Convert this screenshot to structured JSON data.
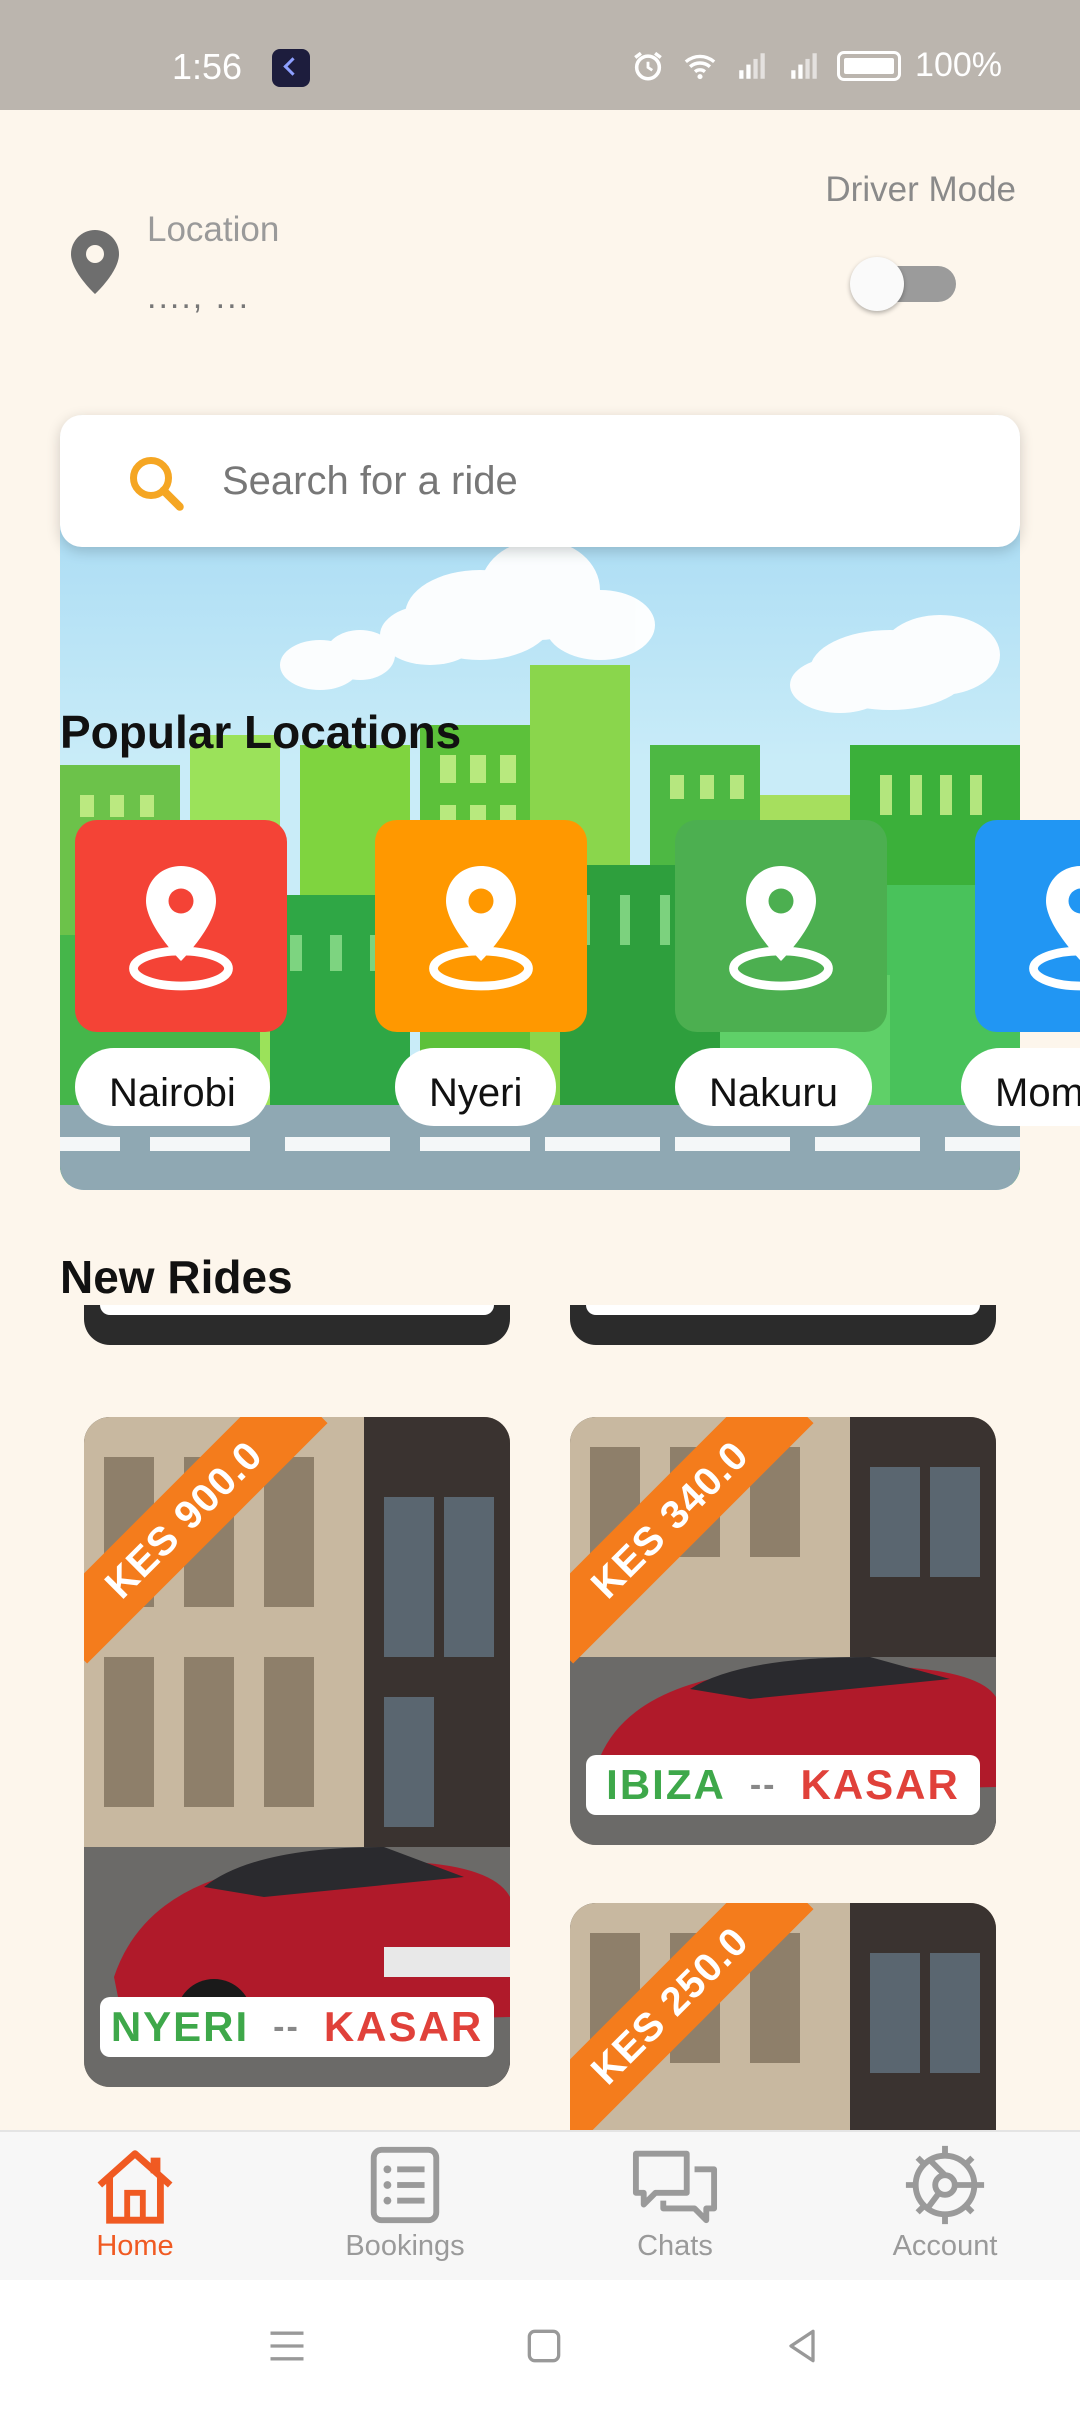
{
  "status_bar": {
    "time": "1:56",
    "battery": "100%"
  },
  "header": {
    "location_label": "Location",
    "location_value": "...., ...",
    "driver_mode_label": "Driver Mode",
    "driver_mode_on": false
  },
  "search": {
    "placeholder": "Search for a ride"
  },
  "popular": {
    "title": "Popular Locations",
    "items": [
      {
        "name": "Nairobi",
        "color": "#f44336"
      },
      {
        "name": "Nyeri",
        "color": "#ff9800"
      },
      {
        "name": "Nakuru",
        "color": "#4caf50"
      },
      {
        "name": "Mom",
        "color": "#2196f3"
      }
    ]
  },
  "new_rides": {
    "title": "New Rides",
    "rides": [
      {
        "price": "KES 900.0",
        "from": "NYERI",
        "separator": "--",
        "to": "KASAR"
      },
      {
        "price": "KES 340.0",
        "from": "IBIZA",
        "separator": "--",
        "to": "KASAR"
      },
      {
        "price": "KES 250.0",
        "from": "",
        "separator": "",
        "to": ""
      }
    ]
  },
  "bottom_nav": {
    "items": [
      {
        "label": "Home",
        "icon": "home-icon",
        "active": true
      },
      {
        "label": "Bookings",
        "icon": "list-icon",
        "active": false
      },
      {
        "label": "Chats",
        "icon": "chat-icon",
        "active": false
      },
      {
        "label": "Account",
        "icon": "gear-icon",
        "active": false
      }
    ]
  },
  "colors": {
    "accent": "#f05a22",
    "ribbon": "#f47c1c",
    "route_from": "#3ea84a",
    "route_to": "#e0413a",
    "background": "#fdf6ec"
  }
}
